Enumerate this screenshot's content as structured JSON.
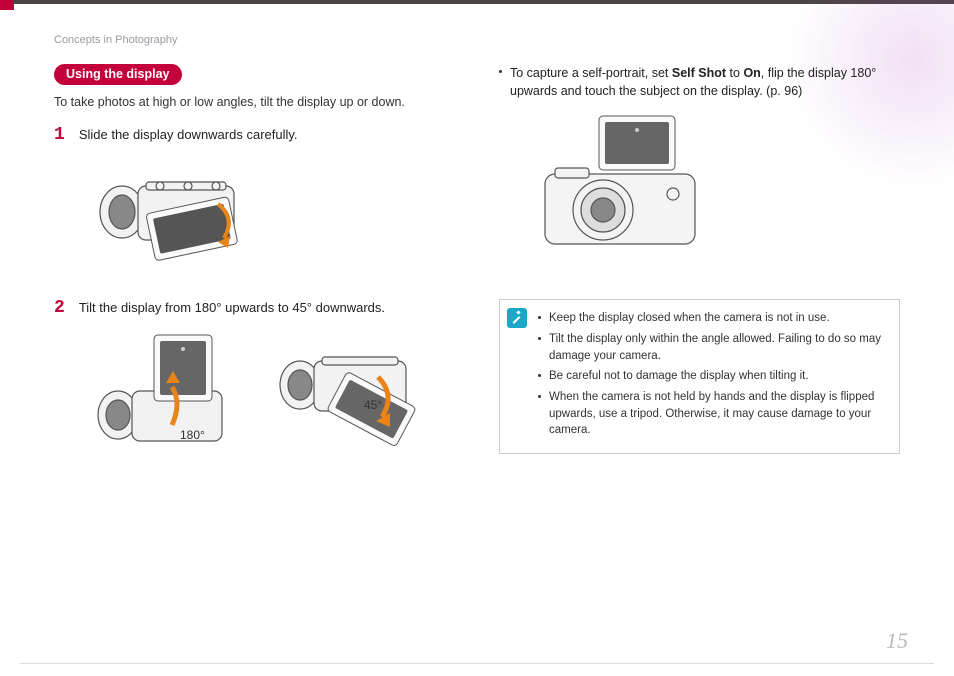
{
  "breadcrumb": "Concepts in Photography",
  "section_title": "Using the display",
  "intro": "To take photos at high or low angles, tilt the display up or down.",
  "steps": [
    {
      "num": "1",
      "text": "Slide the display downwards carefully."
    },
    {
      "num": "2",
      "text": "Tilt the display from 180° upwards to 45° downwards."
    }
  ],
  "angles": {
    "up": "180°",
    "down": "45°"
  },
  "right_bullet": {
    "prefix": "To capture a self-portrait, set ",
    "bold1": "Self Shot",
    "mid": " to ",
    "bold2": "On",
    "suffix": ", flip the display 180° upwards and touch the subject on the display. (p. 96)"
  },
  "notes": [
    "Keep the display closed when the camera is not in use.",
    "Tilt the display only within the angle allowed. Failing to do so may damage your camera.",
    "Be careful not to damage the display when tilting it.",
    "When the camera is not held by hands and the display is flipped upwards, use a tripod. Otherwise, it may cause damage to your camera."
  ],
  "page_number": "15"
}
